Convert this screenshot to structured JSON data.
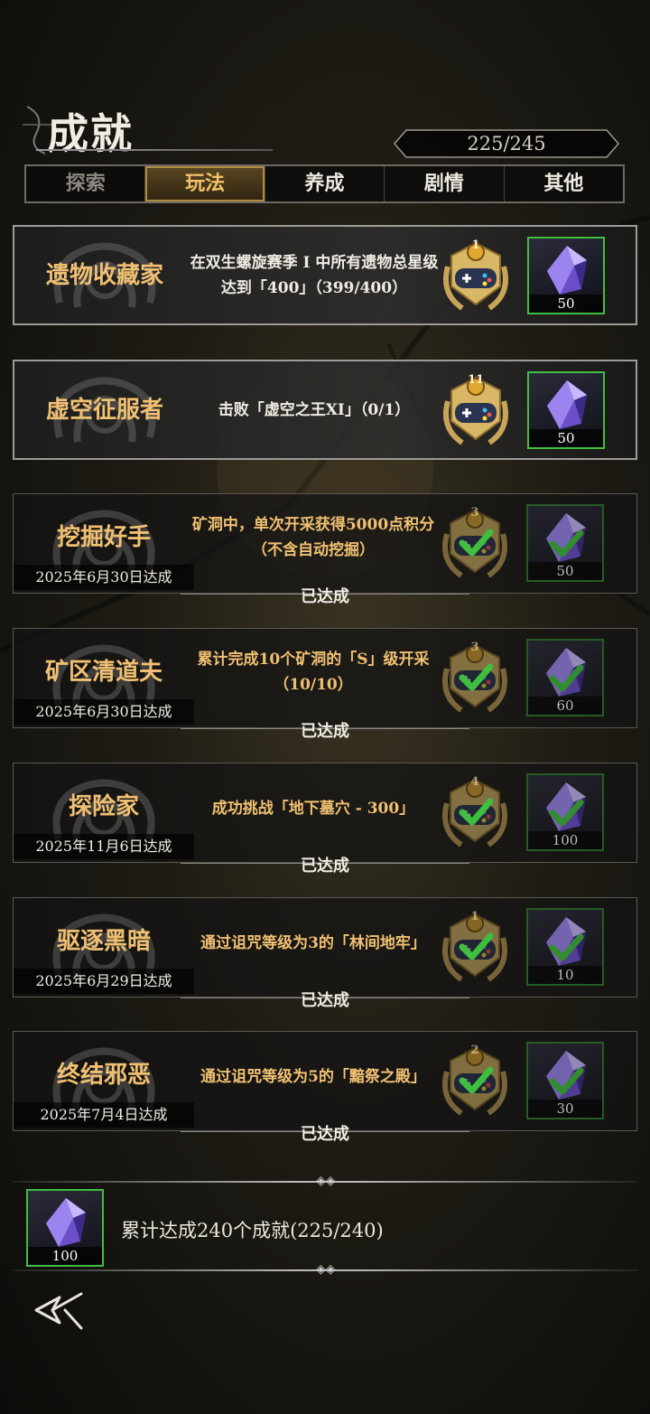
{
  "header": {
    "title": "成就",
    "progress": "225/245"
  },
  "tabs": [
    {
      "label": "探索",
      "state": "disabled"
    },
    {
      "label": "玩法",
      "state": "active"
    },
    {
      "label": "养成",
      "state": "normal"
    },
    {
      "label": "剧情",
      "state": "normal"
    },
    {
      "label": "其他",
      "state": "normal"
    }
  ],
  "achievements": [
    {
      "name": "遗物收藏家",
      "desc": "在双生螺旋赛季 I 中所有遗物总星级达到「400」（399/400）",
      "badge_level": "1",
      "reward": "50",
      "completed": false
    },
    {
      "name": "虚空征服者",
      "desc": "击败「虚空之王XI」（0/1）",
      "badge_level": "11",
      "reward": "50",
      "completed": false
    },
    {
      "name": "挖掘好手",
      "desc": "矿洞中，单次开采获得5000点积分（不含自动挖掘）",
      "badge_level": "3",
      "reward": "50",
      "completed": true,
      "date": "2025年6月30日达成",
      "status": "已达成"
    },
    {
      "name": "矿区清道夫",
      "desc": "累计完成10个矿洞的「S」级开采（10/10）",
      "badge_level": "3",
      "reward": "60",
      "completed": true,
      "date": "2025年6月30日达成",
      "status": "已达成"
    },
    {
      "name": "探险家",
      "desc": "成功挑战「地下墓穴 - 300」",
      "badge_level": "4",
      "reward": "100",
      "completed": true,
      "date": "2025年11月6日达成",
      "status": "已达成"
    },
    {
      "name": "驱逐黑暗",
      "desc": "通过诅咒等级为3的「林间地牢」",
      "badge_level": "1",
      "reward": "10",
      "completed": true,
      "date": "2025年6月29日达成",
      "status": "已达成"
    },
    {
      "name": "终结邪恶",
      "desc": "通过诅咒等级为5的「黯祭之殿」",
      "badge_level": "2",
      "reward": "30",
      "completed": true,
      "date": "2025年7月4日达成",
      "status": "已达成"
    }
  ],
  "total": {
    "reward": "100",
    "text": "累计达成240个成就(225/240)"
  },
  "icons": {
    "back": "back-arrow-icon",
    "badge": "gamepad-laurel-icon",
    "reward": "crystal-gem-icon",
    "check": "checkmark-icon"
  },
  "colors": {
    "accent_gold": "#f0c072",
    "check_green": "#3fbf3f",
    "gem_purple": "#7a5ad8"
  }
}
